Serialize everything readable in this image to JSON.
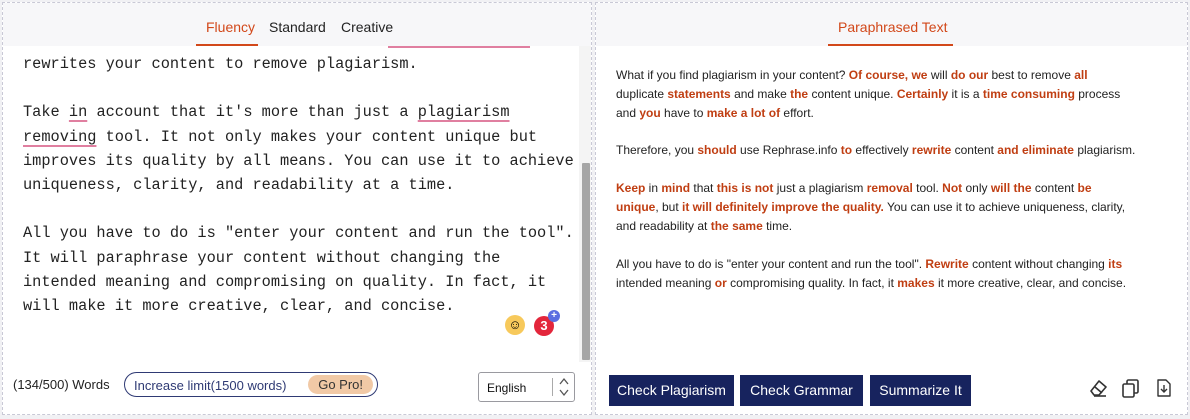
{
  "left": {
    "tabs": [
      {
        "label": "Fluency",
        "active": true
      },
      {
        "label": "Standard",
        "active": false
      },
      {
        "label": "Creative",
        "active": false
      }
    ],
    "editor_lines": {
      "l0": "rewrites your content to remove plagiarism.",
      "l2a": "Take ",
      "l2b": "in",
      "l2c": " account that it's more than just a ",
      "l2d": "plagiarism",
      "l3a": "removing",
      "l3b": " tool. It not only makes your content unique but",
      "l4": "improves its quality by all means. You can use it to achieve",
      "l5": "uniqueness, clarity, and readability at a time.",
      "l7": "All you have to do is \"enter your content and run the tool\".",
      "l8": "It will paraphrase your content without changing the",
      "l9": "intended meaning and compromising on quality. In fact, it",
      "l10": "will make it more creative, clear, and concise."
    },
    "badge_count": "3",
    "word_count": "(134/500) Words",
    "increase_limit_label": "Increase limit(1500 words)",
    "go_pro_label": "Go Pro!",
    "language": "English"
  },
  "right": {
    "header": "Paraphrased Text",
    "p1": {
      "l1": [
        [
          "What  if you find plagiarism in your content? ",
          0
        ],
        [
          "Of course, we",
          1
        ],
        [
          " will ",
          0
        ],
        [
          "do our",
          1
        ],
        [
          " best to remove ",
          0
        ],
        [
          "all",
          1
        ]
      ],
      "l2": [
        [
          "duplicate ",
          0
        ],
        [
          "statements",
          1
        ],
        [
          " and make ",
          0
        ],
        [
          "the",
          1
        ],
        [
          " content unique. ",
          0
        ],
        [
          "Certainly",
          1
        ],
        [
          " it is a ",
          0
        ],
        [
          "time consuming",
          1
        ],
        [
          " process",
          0
        ]
      ],
      "l3": [
        [
          "and ",
          0
        ],
        [
          "you",
          1
        ],
        [
          " have to ",
          0
        ],
        [
          "make a lot of",
          1
        ],
        [
          " effort.",
          0
        ]
      ]
    },
    "p2": {
      "l1": [
        [
          " Therefore, you ",
          0
        ],
        [
          "should",
          1
        ],
        [
          " use Rephrase.info ",
          0
        ],
        [
          "to",
          1
        ],
        [
          " effectively ",
          0
        ],
        [
          "rewrite",
          1
        ],
        [
          " content ",
          0
        ],
        [
          "and eliminate",
          1
        ],
        [
          " plagiarism.",
          0
        ]
      ]
    },
    "p3": {
      "l1": [
        [
          " ",
          0
        ],
        [
          "Keep",
          1
        ],
        [
          " in ",
          0
        ],
        [
          "mind",
          1
        ],
        [
          " that ",
          0
        ],
        [
          "this is not",
          1
        ],
        [
          " just a plagiarism ",
          0
        ],
        [
          "removal",
          1
        ],
        [
          " tool. ",
          0
        ],
        [
          "Not",
          1
        ],
        [
          " only ",
          0
        ],
        [
          "will the",
          1
        ],
        [
          " content ",
          0
        ],
        [
          "be",
          1
        ]
      ],
      "l2": [
        [
          "unique",
          1
        ],
        [
          ", but ",
          0
        ],
        [
          "it will definitely improve the quality.",
          1
        ],
        [
          " You can use it to achieve uniqueness, clarity,",
          0
        ]
      ],
      "l3": [
        [
          "and readability at ",
          0
        ],
        [
          "the same",
          1
        ],
        [
          " time.",
          0
        ]
      ]
    },
    "p4": {
      "l1": [
        [
          " All you have to do is \"enter your content and run the tool\". ",
          0
        ],
        [
          "Rewrite",
          1
        ],
        [
          " content without changing ",
          0
        ],
        [
          "its",
          1
        ]
      ],
      "l2": [
        [
          "intended meaning ",
          0
        ],
        [
          "or",
          1
        ],
        [
          " compromising  quality. In fact, it ",
          0
        ],
        [
          "makes",
          1
        ],
        [
          " it more creative, clear, and concise.",
          0
        ]
      ]
    },
    "buttons": {
      "check_plagiarism": "Check Plagiarism",
      "check_grammar": "Check Grammar",
      "summarize": "Summarize It"
    },
    "icons": [
      "eraser-icon",
      "copy-icon",
      "download-icon"
    ]
  },
  "colors": {
    "accent": "#d2481a",
    "highlight_text": "#c03e12",
    "button_bg": "#17235e",
    "underline_marker": "#e07fa0"
  }
}
